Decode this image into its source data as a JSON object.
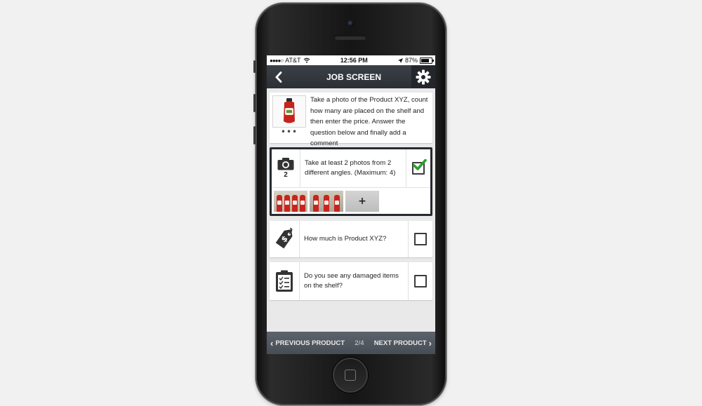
{
  "status_bar": {
    "carrier": "AT&T",
    "time": "12:56 PM",
    "battery": "87%"
  },
  "header": {
    "title": "JOB SCREEN",
    "back_icon": "chevron-left-icon",
    "settings_icon": "gear-icon"
  },
  "intro": {
    "product_image": "ketchup-bottle",
    "more": "•••",
    "text": "Take a photo of the Product XYZ, count how many are placed on the shelf and then enter the price. Answer the question below and finally add a comment"
  },
  "tasks": {
    "photo": {
      "icon": "camera-icon",
      "count": "2",
      "text": "Take at least 2 photos from 2 different angles. (Maximum: 4)",
      "checked": true,
      "add_label": "+"
    },
    "price": {
      "icon": "price-tag-icon",
      "text": "How much is Product XYZ?",
      "checked": false
    },
    "damage": {
      "icon": "clipboard-checklist-icon",
      "text": "Do you see any damaged items on the shelf?",
      "checked": false
    }
  },
  "footer": {
    "prev_label": "PREVIOUS PRODUCT",
    "pager": "2/4",
    "next_label": "NEXT PRODUCT"
  },
  "colors": {
    "header_bg": "#2f343a",
    "check_green": "#2e9e2e",
    "footer_bg": "#525961"
  }
}
